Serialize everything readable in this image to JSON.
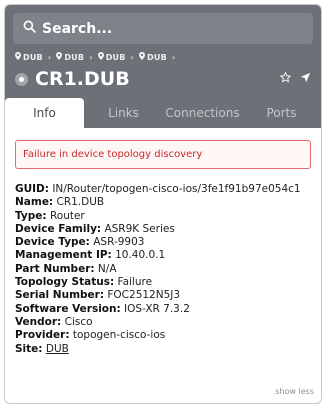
{
  "search": {
    "placeholder": "Search..."
  },
  "breadcrumbs": [
    "DUB",
    "DUB",
    "DUB",
    "DUB"
  ],
  "title": "CR1.DUB",
  "tabs": [
    {
      "label": "Info",
      "active": true
    },
    {
      "label": "Links",
      "active": false
    },
    {
      "label": "Connections",
      "active": false
    },
    {
      "label": "Ports",
      "active": false
    }
  ],
  "alert": "Failure in device topology discovery",
  "properties": [
    {
      "key": "GUID:",
      "value": "IN/Router/topogen-cisco-ios/3fe1f91b97e054c1"
    },
    {
      "key": "Name:",
      "value": "CR1.DUB"
    },
    {
      "key": "Type:",
      "value": "Router"
    },
    {
      "key": "Device Family:",
      "value": "ASR9K Series"
    },
    {
      "key": "Device Type:",
      "value": "ASR-9903"
    },
    {
      "key": "Management IP:",
      "value": "10.40.0.1"
    },
    {
      "key": "Part Number:",
      "value": "N/A"
    },
    {
      "key": "Topology Status:",
      "value": "Failure"
    },
    {
      "key": "Serial Number:",
      "value": "FOC2512N5J3"
    },
    {
      "key": "Software Version:",
      "value": "IOS-XR 7.3.2"
    },
    {
      "key": "Vendor:",
      "value": "Cisco"
    },
    {
      "key": "Provider:",
      "value": "topogen-cisco-ios"
    },
    {
      "key": "Site:",
      "value": "DUB"
    }
  ],
  "show_less": "show less",
  "icons": {
    "search": "search-icon",
    "breadcrumb": "location-pin-icon",
    "title": "device-icon",
    "star": "star-icon",
    "locate": "navigate-icon"
  },
  "colors": {
    "header_bg": "#6b7177",
    "alert_border": "#e36a6a",
    "alert_text": "#c82a2a"
  }
}
